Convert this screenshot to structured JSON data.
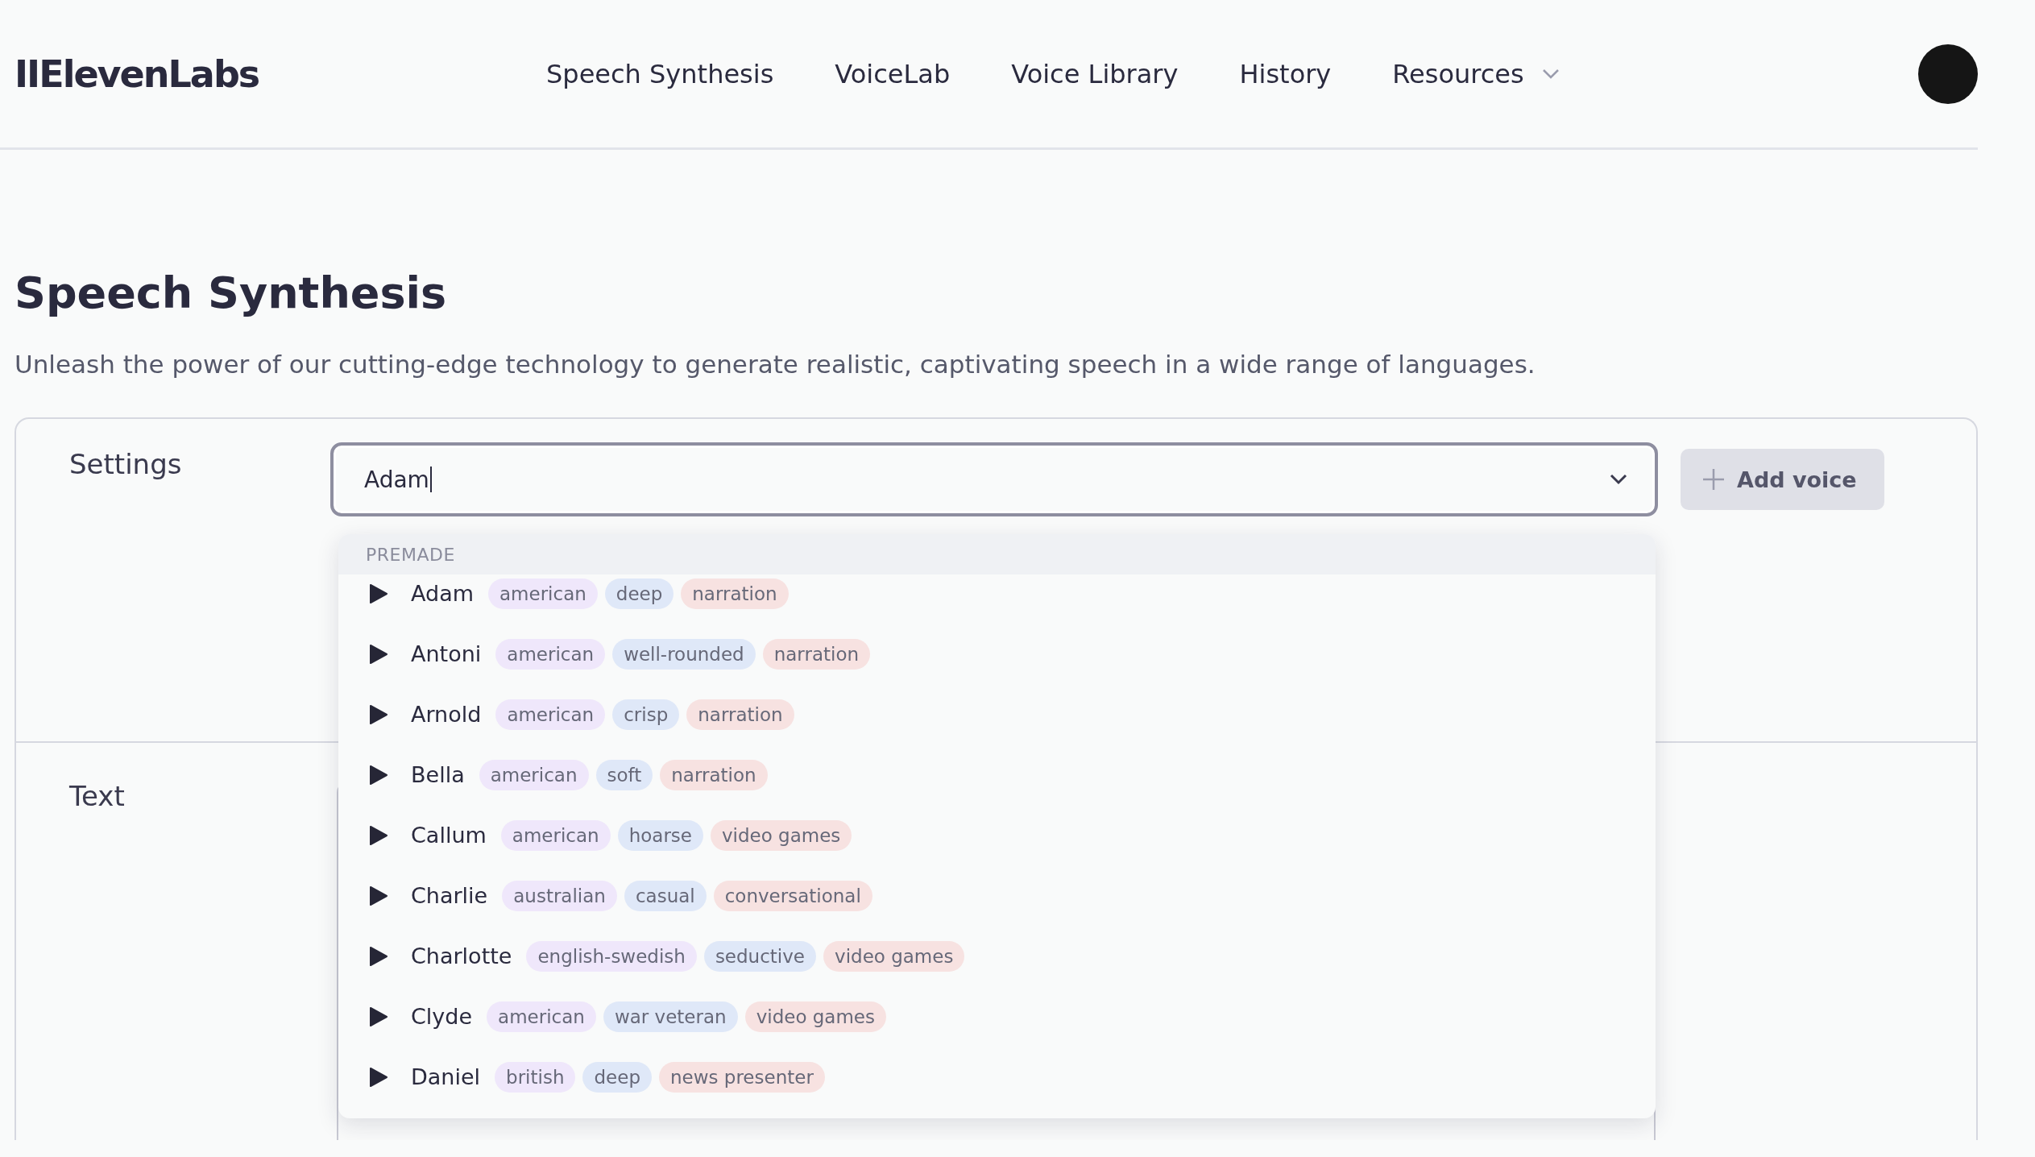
{
  "header": {
    "logo": "IIElevenLabs",
    "nav": [
      {
        "label": "Speech Synthesis",
        "has_menu": false
      },
      {
        "label": "VoiceLab",
        "has_menu": false
      },
      {
        "label": "Voice Library",
        "has_menu": false
      },
      {
        "label": "History",
        "has_menu": false
      },
      {
        "label": "Resources",
        "has_menu": true
      }
    ]
  },
  "page": {
    "title": "Speech Synthesis",
    "subtitle": "Unleash the power of our cutting-edge technology to generate realistic, captivating speech in a wide range of languages."
  },
  "settings": {
    "label": "Settings",
    "voice_field": {
      "value": "Adam",
      "expanded": true
    },
    "add_button": "Add voice"
  },
  "dropdown": {
    "group": "PREMADE",
    "voices": [
      {
        "name": "Adam",
        "tags": [
          {
            "text": "american",
            "kind": "accent"
          },
          {
            "text": "deep",
            "kind": "description"
          },
          {
            "text": "narration",
            "kind": "use"
          }
        ]
      },
      {
        "name": "Antoni",
        "tags": [
          {
            "text": "american",
            "kind": "accent"
          },
          {
            "text": "well-rounded",
            "kind": "description"
          },
          {
            "text": "narration",
            "kind": "use"
          }
        ]
      },
      {
        "name": "Arnold",
        "tags": [
          {
            "text": "american",
            "kind": "accent"
          },
          {
            "text": "crisp",
            "kind": "description"
          },
          {
            "text": "narration",
            "kind": "use"
          }
        ]
      },
      {
        "name": "Bella",
        "tags": [
          {
            "text": "american",
            "kind": "accent"
          },
          {
            "text": "soft",
            "kind": "description"
          },
          {
            "text": "narration",
            "kind": "use"
          }
        ]
      },
      {
        "name": "Callum",
        "tags": [
          {
            "text": "american",
            "kind": "accent"
          },
          {
            "text": "hoarse",
            "kind": "description"
          },
          {
            "text": "video games",
            "kind": "use"
          }
        ]
      },
      {
        "name": "Charlie",
        "tags": [
          {
            "text": "australian",
            "kind": "accent"
          },
          {
            "text": "casual",
            "kind": "description"
          },
          {
            "text": "conversational",
            "kind": "use"
          }
        ]
      },
      {
        "name": "Charlotte",
        "tags": [
          {
            "text": "english-swedish",
            "kind": "accent"
          },
          {
            "text": "seductive",
            "kind": "description"
          },
          {
            "text": "video games",
            "kind": "use"
          }
        ]
      },
      {
        "name": "Clyde",
        "tags": [
          {
            "text": "american",
            "kind": "accent"
          },
          {
            "text": "war veteran",
            "kind": "description"
          },
          {
            "text": "video games",
            "kind": "use"
          }
        ]
      },
      {
        "name": "Daniel",
        "tags": [
          {
            "text": "british",
            "kind": "accent"
          },
          {
            "text": "deep",
            "kind": "description"
          },
          {
            "text": "news presenter",
            "kind": "use"
          }
        ]
      }
    ]
  },
  "text_section": {
    "label": "Text"
  }
}
